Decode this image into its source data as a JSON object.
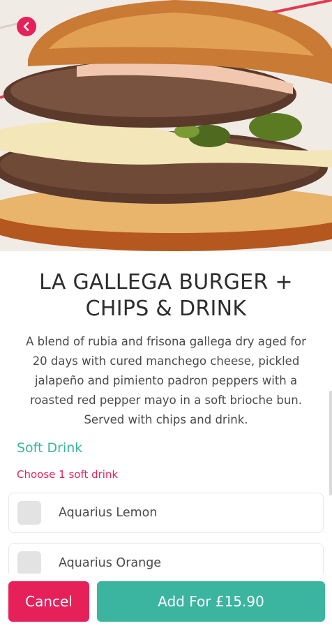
{
  "header": {
    "back_icon": "chevron-left-icon",
    "accent": "#e6215a"
  },
  "product": {
    "title": "LA GALLEGA BURGER + CHIPS & DRINK",
    "description": "A blend of rubia and frisona gallega dry aged for 20 days with cured manchego cheese, pickled jalapeño and pimiento padron peppers with a roasted red pepper mayo in a soft brioche bun. Served with chips and drink."
  },
  "options_group": {
    "title": "Soft Drink",
    "hint": "Choose 1 soft drink",
    "items": [
      {
        "label": "Aquarius Lemon",
        "checked": false
      },
      {
        "label": "Aquarius Orange",
        "checked": false
      }
    ]
  },
  "actions": {
    "cancel_label": "Cancel",
    "add_label": "Add For £15.90"
  },
  "colors": {
    "primary": "#3bb4a0",
    "danger": "#e6215a"
  }
}
